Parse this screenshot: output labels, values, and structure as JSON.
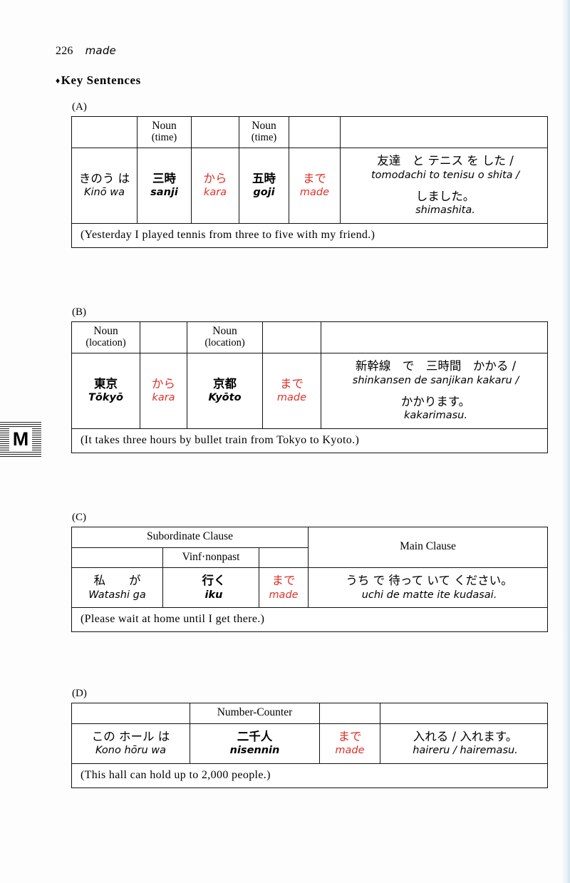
{
  "page": {
    "number": "226",
    "entry_word": "made",
    "section_heading": "Key Sentences",
    "diamond_glyph": "♦",
    "thumb_tab_letter": "M",
    "accent_color": "#e03027",
    "text_color": "#000000"
  },
  "examples": [
    {
      "label": "(A)",
      "headers": [
        "",
        "Noun",
        "",
        "Noun",
        "",
        ""
      ],
      "header_subs": [
        "",
        "(time)",
        "",
        "(time)",
        "",
        ""
      ],
      "cells": [
        {
          "jp": "きのう は",
          "romaji": "Kinō wa"
        },
        {
          "jp": "三時",
          "romaji": "sanji"
        },
        {
          "jp": "から",
          "romaji": "kara"
        },
        {
          "jp": "五時",
          "romaji": "goji"
        },
        {
          "jp": "まで",
          "romaji": "made"
        },
        {
          "jp": "友達　と テニス を した /",
          "romaji": "tomodachi to tenisu o shita /",
          "jp2": "しました。",
          "romaji2": "shimashita."
        }
      ],
      "translation": "(Yesterday I played tennis from three to five with my friend.)"
    },
    {
      "label": "(B)",
      "headers": [
        "Noun",
        "",
        "Noun",
        "",
        ""
      ],
      "header_subs": [
        "(location)",
        "",
        "(location)",
        "",
        ""
      ],
      "cells": [
        {
          "jp": "東京",
          "romaji": "Tōkyō"
        },
        {
          "jp": "から",
          "romaji": "kara"
        },
        {
          "jp": "京都",
          "romaji": "Kyōto"
        },
        {
          "jp": "まで",
          "romaji": "made"
        },
        {
          "jp": "新幹線　で　三時間　かかる /",
          "romaji": "shinkansen de sanjikan kakaru /",
          "jp2": "かかります。",
          "romaji2": "kakarimasu."
        }
      ],
      "translation": "(It takes three hours by bullet train from Tokyo to Kyoto.)"
    },
    {
      "label": "(C)",
      "group_header_left": "Subordinate Clause",
      "group_header_right": "Main Clause",
      "headers": [
        "",
        "Vinf·nonpast",
        ""
      ],
      "cells": [
        {
          "jp": "私　　が",
          "romaji": "Watashi ga"
        },
        {
          "jp": "行く",
          "romaji": "iku"
        },
        {
          "jp": "まで",
          "romaji": "made"
        },
        {
          "jp": "うち で 待って いて ください。",
          "romaji": "uchi de matte  ite  kudasai."
        }
      ],
      "translation": "(Please wait at home until I get there.)"
    },
    {
      "label": "(D)",
      "headers": [
        "",
        "Number-Counter",
        "",
        ""
      ],
      "cells": [
        {
          "jp": "この ホール は",
          "romaji": "Kono hōru wa"
        },
        {
          "jp": "二千人",
          "romaji": "nisennin"
        },
        {
          "jp": "まで",
          "romaji": "made"
        },
        {
          "jp": "入れる / 入れます。",
          "romaji": "haireru / hairemasu."
        }
      ],
      "translation": "(This hall can hold up to 2,000 people.)"
    }
  ]
}
